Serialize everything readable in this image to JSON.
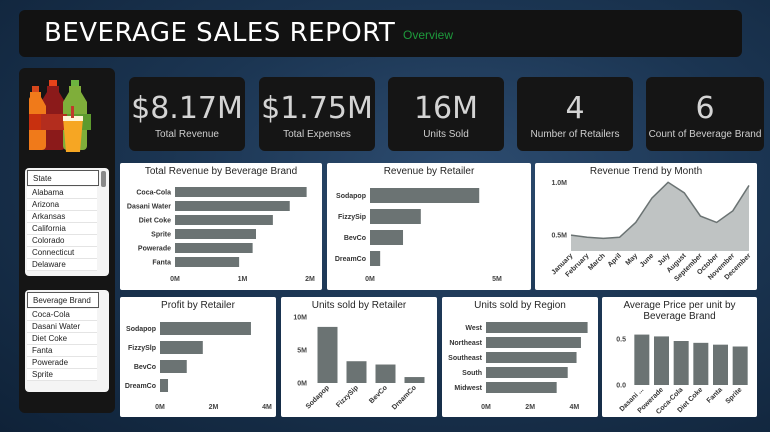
{
  "header": {
    "title": "BEVERAGE SALES REPORT",
    "subtitle": "Overview"
  },
  "kpis": [
    {
      "value": "$8.17M",
      "label": "Total Revenue"
    },
    {
      "value": "$1.75M",
      "label": "Total Expenses"
    },
    {
      "value": "16M",
      "label": "Units Sold"
    },
    {
      "value": "4",
      "label": "Number of Retailers"
    },
    {
      "value": "6",
      "label": "Count of Beverage Brand"
    }
  ],
  "slicers": {
    "state": {
      "header": "State",
      "items": [
        "Alabama",
        "Arizona",
        "Arkansas",
        "California",
        "Colorado",
        "Connecticut",
        "Delaware"
      ]
    },
    "brand": {
      "header": "Beverage Brand",
      "items": [
        "Coca-Cola",
        "Dasani Water",
        "Diet Coke",
        "Fanta",
        "Powerade",
        "Sprite"
      ]
    }
  },
  "colors": {
    "bar": "#6b7373",
    "area": "#bfc3c3",
    "line": "#6b7373",
    "header_bg": "#121212",
    "accent": "#1e9a3c"
  },
  "icon": "beverage-bottles-icon",
  "chart_data": [
    {
      "id": "rev_brand",
      "type": "bar",
      "orientation": "horizontal",
      "title": "Total Revenue by Beverage Brand",
      "categories": [
        "Coca-Cola",
        "Dasani Water",
        "Diet Coke",
        "Sprite",
        "Powerade",
        "Fanta"
      ],
      "values": [
        1.95,
        1.7,
        1.45,
        1.2,
        1.15,
        0.95
      ],
      "xlim": [
        0,
        2
      ],
      "ticks": [
        0,
        1,
        2
      ],
      "tick_labels": [
        "0M",
        "1M",
        "2M"
      ]
    },
    {
      "id": "rev_retailer",
      "type": "bar",
      "orientation": "horizontal",
      "title": "Revenue by Retailer",
      "categories": [
        "Sodapop",
        "FizzySip",
        "BevCo",
        "DreamCo"
      ],
      "values": [
        4.3,
        2.0,
        1.3,
        0.4
      ],
      "xlim": [
        0,
        5
      ],
      "ticks": [
        0,
        5
      ],
      "tick_labels": [
        "0M",
        "5M"
      ]
    },
    {
      "id": "rev_trend",
      "type": "area",
      "title": "Revenue Trend by Month",
      "categories": [
        "January",
        "February",
        "March",
        "April",
        "May",
        "June",
        "July",
        "August",
        "September",
        "October",
        "November",
        "December"
      ],
      "values": [
        0.5,
        0.48,
        0.47,
        0.48,
        0.62,
        0.85,
        1.0,
        0.9,
        0.68,
        0.62,
        0.73,
        0.97
      ],
      "ylim": [
        0.35,
        1.05
      ],
      "ticks": [
        0.5,
        1.0
      ],
      "tick_labels": [
        "0.5M",
        "1.0M"
      ]
    },
    {
      "id": "profit_retailer",
      "type": "bar",
      "orientation": "horizontal",
      "title": "Profit by Retailer",
      "categories": [
        "Sodapop",
        "FizzySlp",
        "BevCo",
        "DreamCo"
      ],
      "values": [
        3.4,
        1.6,
        1.0,
        0.3
      ],
      "xlim": [
        0,
        4
      ],
      "ticks": [
        0,
        2,
        4
      ],
      "tick_labels": [
        "0M",
        "2M",
        "4M"
      ]
    },
    {
      "id": "units_retailer",
      "type": "bar",
      "orientation": "vertical",
      "title": "Units sold by Retailer",
      "categories": [
        "Sodapop",
        "FizzySip",
        "BevCo",
        "DreamCo"
      ],
      "values": [
        8.5,
        3.3,
        2.8,
        0.9
      ],
      "ylim": [
        0,
        10
      ],
      "ticks": [
        0,
        5,
        10
      ],
      "tick_labels": [
        "0M",
        "5M",
        "10M"
      ]
    },
    {
      "id": "units_region",
      "type": "bar",
      "orientation": "horizontal",
      "title": "Units sold by Region",
      "categories": [
        "West",
        "Northeast",
        "Southeast",
        "South",
        "Midwest"
      ],
      "values": [
        4.6,
        4.3,
        4.1,
        3.7,
        3.2
      ],
      "xlim": [
        0,
        4.8
      ],
      "ticks": [
        0,
        2,
        4
      ],
      "tick_labels": [
        "0M",
        "2M",
        "4M"
      ]
    },
    {
      "id": "avg_price",
      "type": "bar",
      "orientation": "vertical",
      "title": "Average Price per unit by Beverage Brand",
      "categories": [
        "Dasani ...",
        "Powerade",
        "Coca-Cola",
        "Diet Coke",
        "Fanta",
        "Sprite"
      ],
      "values": [
        0.55,
        0.53,
        0.48,
        0.46,
        0.44,
        0.42
      ],
      "ylim": [
        0,
        0.6
      ],
      "ticks": [
        0,
        0.5
      ],
      "tick_labels": [
        "0.0",
        "0.5"
      ]
    }
  ]
}
